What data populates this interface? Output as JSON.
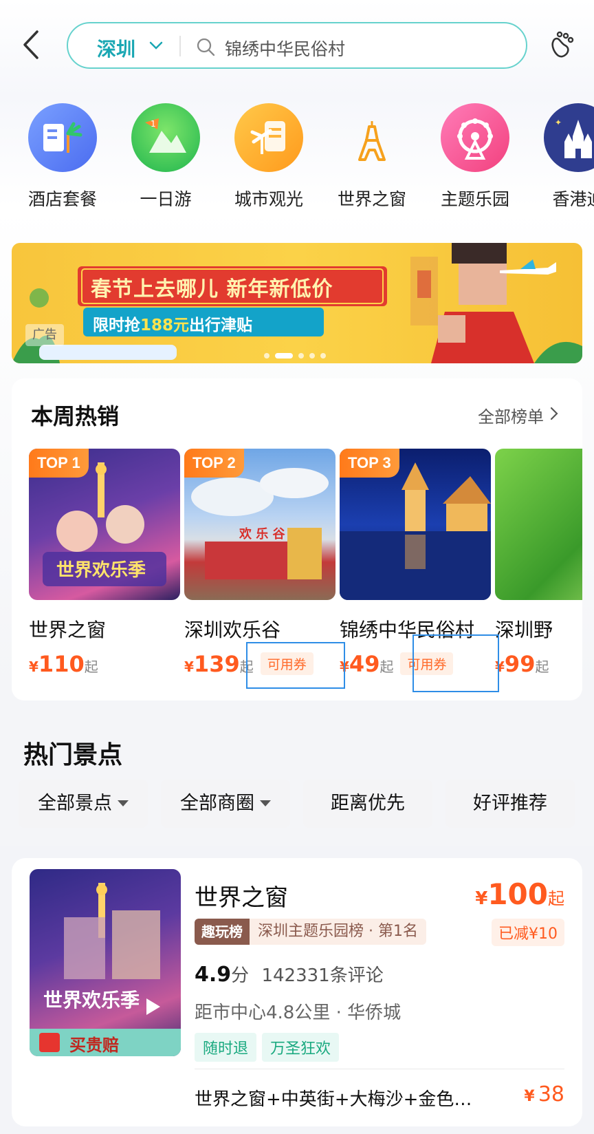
{
  "header": {
    "city": "深圳",
    "search_text": "锦绣中华民俗村"
  },
  "categories": [
    {
      "label": "酒店套餐",
      "icon": "hotel-package-icon",
      "color": "#5a7ef8"
    },
    {
      "label": "一日游",
      "icon": "mountain-flag-icon",
      "color": "#3ecf5a"
    },
    {
      "label": "城市观光",
      "icon": "city-tour-icon",
      "color": "#fbb22a"
    },
    {
      "label": "世界之窗",
      "icon": "eiffel-tower-icon",
      "color": "#f6a11d"
    },
    {
      "label": "主题乐园",
      "icon": "ferris-wheel-icon",
      "color": "#f65598"
    },
    {
      "label": "香港迪",
      "icon": "castle-icon",
      "color": "#2f3d8f"
    }
  ],
  "banner": {
    "title": "春节上去哪儿 新年新低价",
    "sub_prefix": "限时抢",
    "sub_amount": "188元",
    "sub_suffix": "出行津贴",
    "ad_label": "广告"
  },
  "weekly_hot": {
    "title": "本周热销",
    "all_link": "全部榜单",
    "items": [
      {
        "rank": "TOP 1",
        "name": "世界之窗",
        "yen": "¥",
        "price": "110",
        "suffix": "起",
        "coupon": ""
      },
      {
        "rank": "TOP 2",
        "name": "深圳欢乐谷",
        "yen": "¥",
        "price": "139",
        "suffix": "起",
        "coupon": "可用券"
      },
      {
        "rank": "TOP 3",
        "name": "锦绣中华民俗村",
        "yen": "¥",
        "price": "49",
        "suffix": "起",
        "coupon": "可用券"
      },
      {
        "rank": "",
        "name": "深圳野",
        "yen": "¥",
        "price": "99",
        "suffix": "起",
        "coupon": ""
      }
    ]
  },
  "sights": {
    "title": "热门景点",
    "filters": [
      "全部景点",
      "全部商圈",
      "距离优先",
      "好评推荐"
    ]
  },
  "listing": {
    "name": "世界之窗",
    "yen": "¥",
    "price": "100",
    "suffix": "起",
    "reduced": "已减¥10",
    "rank_tag_label": "趣玩榜",
    "rank_tag_text": "深圳主题乐园榜 · 第1名",
    "score": "4.9",
    "score_unit": "分",
    "reviews": "142331条评论",
    "distance": "距市中心4.8公里 · 华侨城",
    "tags": [
      "随时退",
      "万圣狂欢"
    ],
    "image_caption": "买贵赔",
    "combo_text": "世界之窗+中英街+大梅沙+金色…",
    "combo_yen": "¥",
    "combo_price": "38"
  }
}
